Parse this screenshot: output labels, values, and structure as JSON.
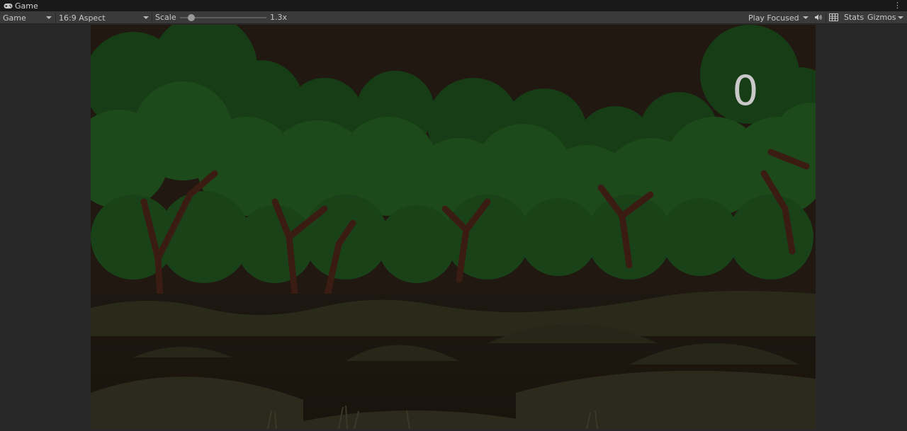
{
  "window": {
    "tab_title": "Game",
    "menu_glyph": "⋮"
  },
  "toolbar": {
    "display": "Game",
    "aspect": "16:9 Aspect",
    "scale_label": "Scale",
    "scale_value": "1.3x",
    "play_mode": "Play Focused",
    "stats": "Stats",
    "gizmos": "Gizmos"
  },
  "game": {
    "score": "0"
  },
  "icons": {
    "tab": "gamepad-icon",
    "audio": "speaker-icon",
    "stats_grid": "grid-icon"
  },
  "colors": {
    "editor_bg": "#282828",
    "toolbar_bg": "#3a3a3a",
    "foliage": "#1f4a1b",
    "sky": "#201811",
    "score_text": "#c9c9c9"
  }
}
